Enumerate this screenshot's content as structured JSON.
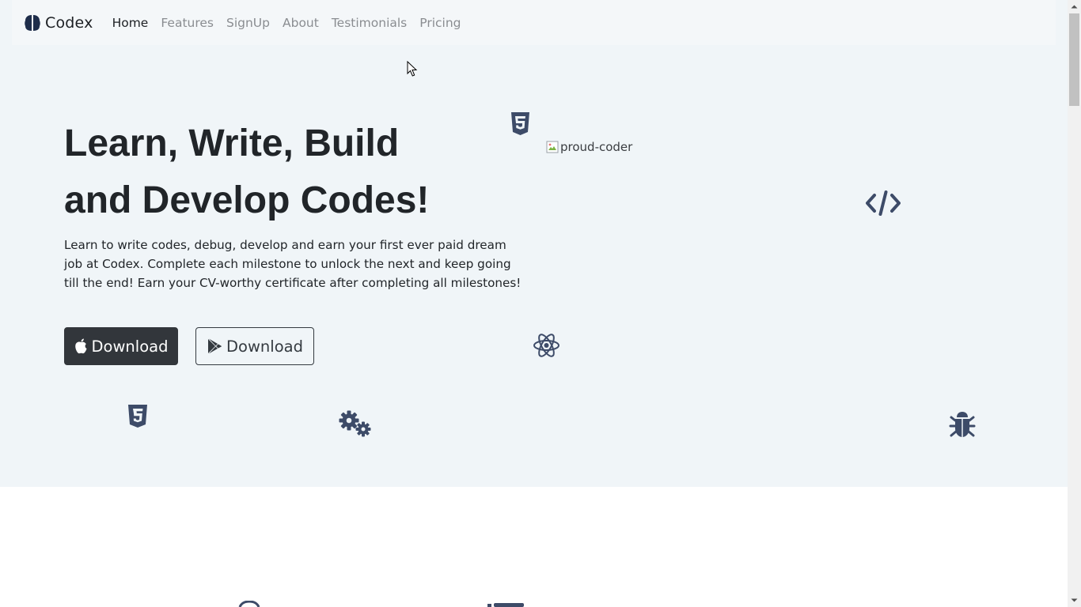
{
  "navbar": {
    "brand": "Codex",
    "links": [
      {
        "label": "Home",
        "active": true
      },
      {
        "label": "Features",
        "active": false
      },
      {
        "label": "SignUp",
        "active": false
      },
      {
        "label": "About",
        "active": false
      },
      {
        "label": "Testimonials",
        "active": false
      },
      {
        "label": "Pricing",
        "active": false
      }
    ]
  },
  "hero": {
    "title_line1": "Learn, Write, Build",
    "title_line2": "and Develop Codes!",
    "description": "Learn to write codes, debug, develop and earn your first ever paid dream job at Codex. Complete each milestone to unlock the next and keep going till the end! Earn your CV-worthy certificate after completing all milestones!",
    "buttons": {
      "apple_download": "Download",
      "play_download": "Download"
    },
    "image_alt": "proud-coder"
  },
  "icons": {
    "brand": "brain-icon",
    "apple": "apple-icon",
    "play": "google-play-icon",
    "floating": [
      "html5-icon",
      "code-icon",
      "react-icon",
      "css3-icon",
      "gears-icon",
      "bug-icon"
    ]
  },
  "colors": {
    "hero_bg": "#f0f5f8",
    "navbar_bg": "#f4f7f9",
    "icon": "#3d4b68",
    "dark_button": "#32363b"
  }
}
